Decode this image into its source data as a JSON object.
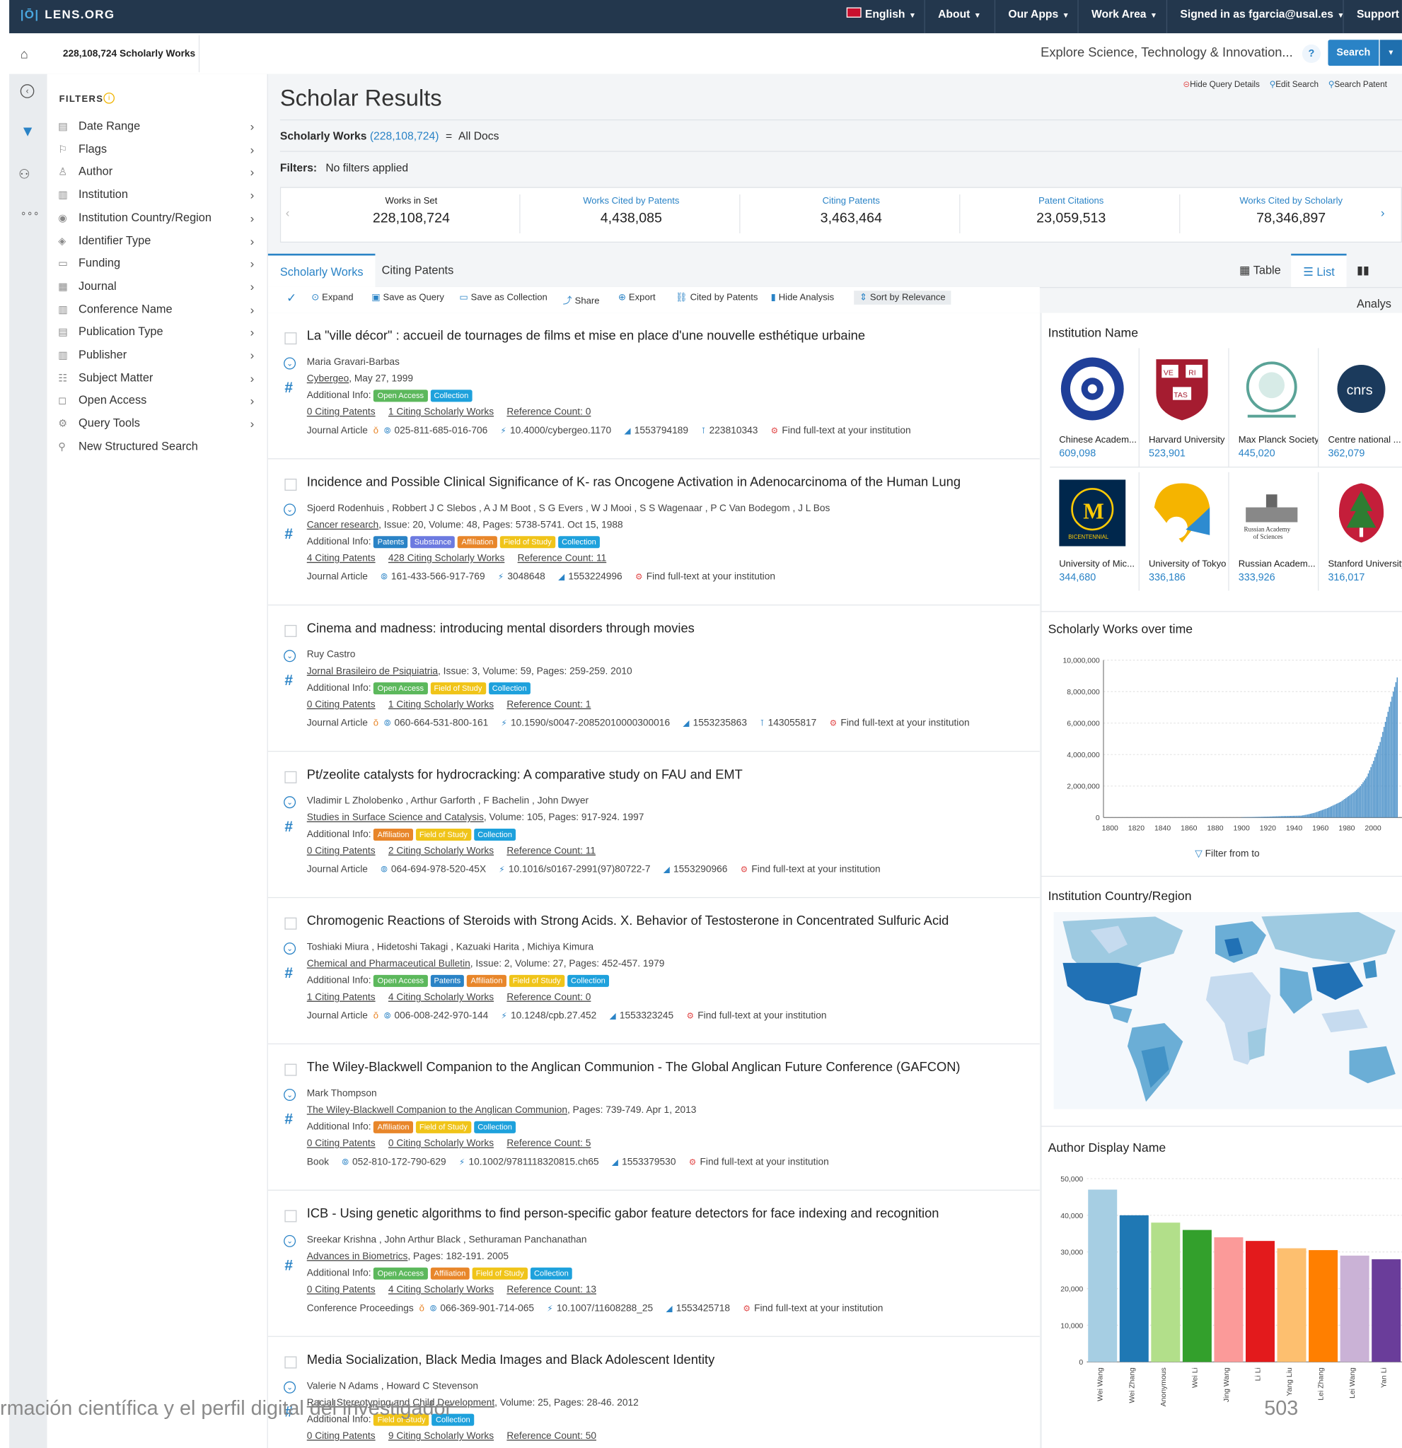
{
  "topbar": {
    "logo": "LENS.ORG",
    "nav": [
      {
        "label": "English",
        "icon": "uk-flag-icon"
      },
      {
        "label": "About"
      },
      {
        "label": "Our Apps"
      },
      {
        "label": "Work Area"
      },
      {
        "label": "Signed in as fgarcia@usal.es"
      },
      {
        "label": "Support"
      }
    ]
  },
  "breadcrumb": {
    "label": "228,108,724 Scholarly Works"
  },
  "search": {
    "placeholder": "Explore Science, Technology & Innovation...",
    "help": "?",
    "button": "Search"
  },
  "query_links": [
    "Hide Query Details",
    "Edit Search",
    "Search Patent"
  ],
  "sidebar": {
    "title": "FILTERS",
    "items": [
      "Date Range",
      "Flags",
      "Author",
      "Institution",
      "Institution Country/Region",
      "Identifier Type",
      "Funding",
      "Journal",
      "Conference Name",
      "Publication Type",
      "Publisher",
      "Subject Matter",
      "Open Access",
      "Query Tools",
      "New Structured Search"
    ]
  },
  "page": {
    "title": "Scholar Results",
    "query_label": "Scholarly Works",
    "query_count": "(228,108,724)",
    "query_eq": "=",
    "query_all": "All Docs",
    "filters_label": "Filters:",
    "filters_value": "No filters applied"
  },
  "stats": [
    {
      "label": "Works in Set",
      "value": "228,108,724"
    },
    {
      "label": "Works Cited by Patents",
      "value": "4,438,085"
    },
    {
      "label": "Citing Patents",
      "value": "3,463,464"
    },
    {
      "label": "Patent Citations",
      "value": "23,059,513"
    },
    {
      "label": "Works Cited by Scholarly",
      "value": "78,346,897"
    }
  ],
  "tabs": [
    "Scholarly Works",
    "Citing Patents"
  ],
  "views": [
    "Table",
    "List",
    "Analys"
  ],
  "toolbar": [
    "Expand",
    "Save as Query",
    "Save as Collection",
    "Share",
    "Export",
    "Cited by Patents",
    "Hide Analysis",
    "Sort by Relevance"
  ],
  "results": [
    {
      "title": "La \"ville décor\" : accueil de tournages de films et mise en place d'une nouvelle esthétique urbaine",
      "authors": "Maria Gravari-Barbas",
      "source": "Cybergeo",
      "source_rest": ", May 27, 1999",
      "badges": [
        [
          "Open Access",
          "oa"
        ],
        [
          "Collection",
          "col"
        ]
      ],
      "citing_patents": "0 Citing Patents",
      "citing_works": "1 Citing Scholarly Works",
      "refcount": "Reference Count: 0",
      "type": "Journal Article",
      "ids": [
        "025-811-685-016-706",
        "10.4000/cybergeo.1170",
        "1553794189",
        "223810343"
      ],
      "fulltext": "Find full-text at your institution"
    },
    {
      "title": "Incidence and Possible Clinical Significance of K- ras Oncogene Activation in Adenocarcinoma of the Human Lung",
      "authors": "Sjoerd Rodenhuis , Robbert J C Slebos , A J M Boot , S G Evers , W J Mooi , S S Wagenaar , P C Van Bodegom , J L Bos",
      "source": "Cancer research",
      "source_rest": ", Issue: 20, Volume: 48, Pages: 5738-5741. Oct 15, 1988",
      "badges": [
        [
          "Patents",
          "pat"
        ],
        [
          "Substance",
          "sub"
        ],
        [
          "Affiliation",
          "aff"
        ],
        [
          "Field of Study",
          "fos"
        ],
        [
          "Collection",
          "col"
        ]
      ],
      "citing_patents": "4 Citing Patents",
      "citing_works": "428 Citing Scholarly Works",
      "refcount": "Reference Count: 11",
      "type": "Journal Article",
      "ids": [
        "161-433-566-917-769",
        "3048648",
        "1553224996"
      ],
      "fulltext": "Find full-text at your institution"
    },
    {
      "title": "Cinema and madness: introducing mental disorders through movies",
      "authors": "Ruy Castro",
      "source": "Jornal Brasileiro de Psiquiatria",
      "source_rest": ", Issue: 3, Volume: 59, Pages: 259-259. 2010",
      "badges": [
        [
          "Open Access",
          "oa"
        ],
        [
          "Field of Study",
          "fos"
        ],
        [
          "Collection",
          "col"
        ]
      ],
      "citing_patents": "0 Citing Patents",
      "citing_works": "1 Citing Scholarly Works",
      "refcount": "Reference Count: 1",
      "type": "Journal Article",
      "ids": [
        "060-664-531-800-161",
        "10.1590/s0047-20852010000300016",
        "1553235863",
        "143055817"
      ],
      "fulltext": "Find full-text at your institution"
    },
    {
      "title": "Pt/zeolite catalysts for hydrocracking: A comparative study on FAU and EMT",
      "authors": "Vladimir L Zholobenko , Arthur Garforth , F Bachelin , John Dwyer",
      "source": "Studies in Surface Science and Catalysis",
      "source_rest": ", Volume: 105, Pages: 917-924. 1997",
      "badges": [
        [
          "Affiliation",
          "aff"
        ],
        [
          "Field of Study",
          "fos"
        ],
        [
          "Collection",
          "col"
        ]
      ],
      "citing_patents": "0 Citing Patents",
      "citing_works": "2 Citing Scholarly Works",
      "refcount": "Reference Count: 11",
      "type": "Journal Article",
      "ids": [
        "064-694-978-520-45X",
        "10.1016/s0167-2991(97)80722-7",
        "1553290966"
      ],
      "fulltext": "Find full-text at your institution"
    },
    {
      "title": "Chromogenic Reactions of Steroids with Strong Acids. X. Behavior of Testosterone in Concentrated Sulfuric Acid",
      "authors": "Toshiaki Miura , Hidetoshi Takagi , Kazuaki Harita , Michiya Kimura",
      "source": "Chemical and Pharmaceutical Bulletin",
      "source_rest": ", Issue: 2, Volume: 27, Pages: 452-457. 1979",
      "badges": [
        [
          "Open Access",
          "oa"
        ],
        [
          "Patents",
          "pat"
        ],
        [
          "Affiliation",
          "aff"
        ],
        [
          "Field of Study",
          "fos"
        ],
        [
          "Collection",
          "col"
        ]
      ],
      "citing_patents": "1 Citing Patents",
      "citing_works": "4 Citing Scholarly Works",
      "refcount": "Reference Count: 0",
      "type": "Journal Article",
      "ids": [
        "006-008-242-970-144",
        "10.1248/cpb.27.452",
        "1553323245"
      ],
      "fulltext": "Find full-text at your institution"
    },
    {
      "title": "The Wiley-Blackwell Companion to the Anglican Communion - The Global Anglican Future Conference (GAFCON)",
      "authors": "Mark Thompson",
      "source": "The Wiley-Blackwell Companion to the Anglican Communion",
      "source_rest": ", Pages: 739-749. Apr 1, 2013",
      "badges": [
        [
          "Affiliation",
          "aff"
        ],
        [
          "Field of Study",
          "fos"
        ],
        [
          "Collection",
          "col"
        ]
      ],
      "citing_patents": "0 Citing Patents",
      "citing_works": "0 Citing Scholarly Works",
      "refcount": "Reference Count: 5",
      "type": "Book",
      "ids": [
        "052-810-172-790-629",
        "10.1002/9781118320815.ch65",
        "1553379530"
      ],
      "fulltext": "Find full-text at your institution"
    },
    {
      "title": "ICB - Using genetic algorithms to find person-specific gabor feature detectors for face indexing and recognition",
      "authors": "Sreekar Krishna , John Arthur Black , Sethuraman Panchanathan",
      "source": "Advances in Biometrics",
      "source_rest": ", Pages: 182-191. 2005",
      "badges": [
        [
          "Open Access",
          "oa"
        ],
        [
          "Affiliation",
          "aff"
        ],
        [
          "Field of Study",
          "fos"
        ],
        [
          "Collection",
          "col"
        ]
      ],
      "citing_patents": "0 Citing Patents",
      "citing_works": "4 Citing Scholarly Works",
      "refcount": "Reference Count: 13",
      "type": "Conference Proceedings",
      "ids": [
        "066-369-901-714-065",
        "10.1007/11608288_25",
        "1553425718"
      ],
      "fulltext": "Find full-text at your institution"
    },
    {
      "title": "Media Socialization, Black Media Images and Black Adolescent Identity",
      "authors": "Valerie N Adams , Howard C Stevenson",
      "source": "Racial Stereotyping and Child Development",
      "source_rest": ", Volume: 25, Pages: 28-46. 2012",
      "badges": [
        [
          "Field of Study",
          "fos"
        ],
        [
          "Collection",
          "col"
        ]
      ],
      "citing_patents": "0 Citing Patents",
      "citing_works": "9 Citing Scholarly Works",
      "refcount": "Reference Count: 50",
      "type": "",
      "ids": [],
      "fulltext": ""
    }
  ],
  "labels": {
    "additional_info": "Additional Info:"
  },
  "institutions": {
    "title": "Institution Name",
    "items": [
      {
        "name": "Chinese Academ...",
        "count": "609,098",
        "logo": "chinese-academy-logo"
      },
      {
        "name": "Harvard University",
        "count": "523,901",
        "logo": "harvard-shield-logo",
        "logo_text": [
          "VE",
          "RI",
          "TAS"
        ]
      },
      {
        "name": "Max Planck Society",
        "count": "445,020",
        "logo": "max-planck-logo"
      },
      {
        "name": "Centre national ...",
        "count": "362,079",
        "logo": "cnrs-logo",
        "logo_text": [
          "cnrs"
        ]
      },
      {
        "name": "University of Mic...",
        "count": "344,680",
        "logo": "michigan-logo",
        "logo_text": [
          "M",
          "BICENTENNIAL"
        ]
      },
      {
        "name": "University of Tokyo",
        "count": "336,186",
        "logo": "tokyo-logo"
      },
      {
        "name": "Russian Academ...",
        "count": "333,926",
        "logo": "russian-academy-logo",
        "logo_text": [
          "Russian Academy",
          "of Sciences"
        ]
      },
      {
        "name": "Stanford University",
        "count": "316,017",
        "logo": "stanford-tree-logo"
      }
    ]
  },
  "chart_time": {
    "title": "Scholarly Works over time",
    "filter_label": "Filter from to"
  },
  "map": {
    "title": "Institution Country/Region"
  },
  "chart_authors": {
    "title": "Author Display Name"
  },
  "chart_data": [
    {
      "type": "bar",
      "title": "Scholarly Works over time",
      "ylim": [
        0,
        10000000
      ],
      "yticks": [
        "10,000,000",
        "8,000,000",
        "6,000,000",
        "4,000,000",
        "2,000,000",
        "0"
      ],
      "xticks": [
        "1800",
        "1820",
        "1840",
        "1860",
        "1880",
        "1900",
        "1920",
        "1940",
        "1960",
        "1980",
        "2000"
      ],
      "x": [
        1900,
        1910,
        1920,
        1930,
        1940,
        1945,
        1950,
        1955,
        1960,
        1965,
        1970,
        1975,
        1980,
        1985,
        1990,
        1995,
        2000,
        2005,
        2010,
        2015,
        2019
      ],
      "values": [
        20000,
        40000,
        60000,
        90000,
        110000,
        120000,
        200000,
        300000,
        450000,
        600000,
        800000,
        1000000,
        1300000,
        1600000,
        2000000,
        2600000,
        3600000,
        4800000,
        6400000,
        8000000,
        9200000
      ]
    },
    {
      "type": "bar",
      "title": "Author Display Name",
      "ylim": [
        0,
        50000
      ],
      "yticks": [
        "50,000",
        "40,000",
        "30,000",
        "20,000",
        "10,000",
        "0"
      ],
      "categories": [
        "Wei Wang",
        "Wei Zhang",
        "Anonymous",
        "Wei Li",
        "Jing Wang",
        "Li Li",
        "Yang Liu",
        "Lei Zhang",
        "Lei Wang",
        "Yan Li"
      ],
      "values": [
        47000,
        40000,
        38000,
        36000,
        34000,
        33000,
        31000,
        30500,
        29000,
        28000
      ],
      "colors": [
        "#a6cee3",
        "#1f78b4",
        "#b2df8a",
        "#33a02c",
        "#fb9a99",
        "#e31a1c",
        "#fdbf6f",
        "#ff7f00",
        "#cab2d6",
        "#6a3d9a"
      ]
    }
  ],
  "overlay": {
    "caption": "rmación científica y el perfil digital del investigador",
    "page_number": "503"
  }
}
